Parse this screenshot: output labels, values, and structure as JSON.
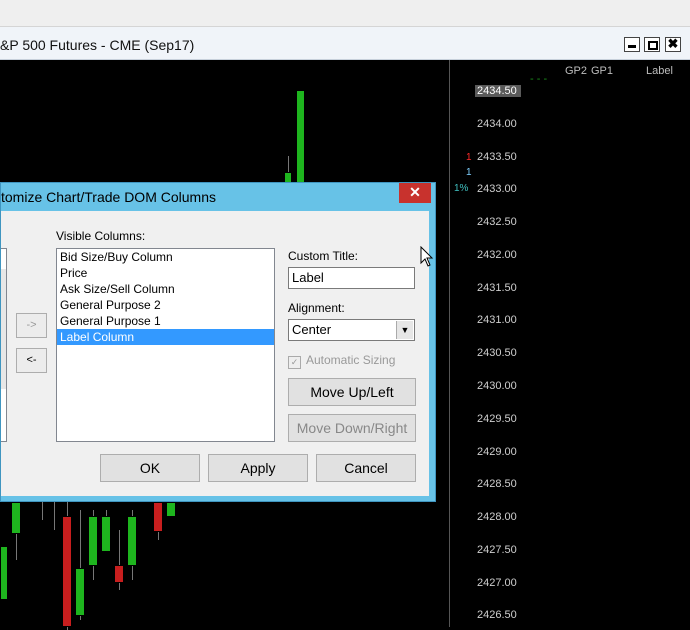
{
  "window": {
    "title": "&P 500 Futures - CME (Sep17)",
    "controls": {
      "minimize": "minimize",
      "maximize": "maximize",
      "close": "✖"
    }
  },
  "dom": {
    "headers": [
      "GP2",
      "GP1",
      "Label"
    ],
    "dashes": "- - -",
    "prices": [
      "2434.50",
      "2434.00",
      "2433.50",
      "2433.00",
      "2432.50",
      "2432.00",
      "2431.50",
      "2431.00",
      "2430.50",
      "2430.00",
      "2429.50",
      "2429.00",
      "2428.50",
      "2428.00",
      "2427.50",
      "2427.00",
      "2426.50"
    ],
    "gp_red": "1",
    "gp_cyan": "1",
    "pct": "1%"
  },
  "dialog": {
    "title": "tomize Chart/Trade DOM Columns",
    "close_label": "✕",
    "visible_columns_label": "Visible Columns:",
    "visible_columns": [
      "Bid Size/Buy Column",
      "Price",
      "Ask Size/Sell Column",
      "General Purpose 2",
      "General Purpose 1",
      "Label Column"
    ],
    "selected_index": 5,
    "add_arrow": "->",
    "remove_arrow": "<-",
    "custom_title_label": "Custom Title:",
    "custom_title_value": "Label",
    "alignment_label": "Alignment:",
    "alignment_value": "Center",
    "automatic_sizing_label": "Automatic Sizing",
    "move_up_label": "Move Up/Left",
    "move_down_label": "Move Down/Right",
    "ok_label": "OK",
    "apply_label": "Apply",
    "cancel_label": "Cancel"
  },
  "colors": {
    "up_candle": "#1eb51e",
    "down_candle": "#c81e1e",
    "dialog_frame": "#67c2e7",
    "close_button": "#c8322d",
    "selection": "#3399ff"
  }
}
